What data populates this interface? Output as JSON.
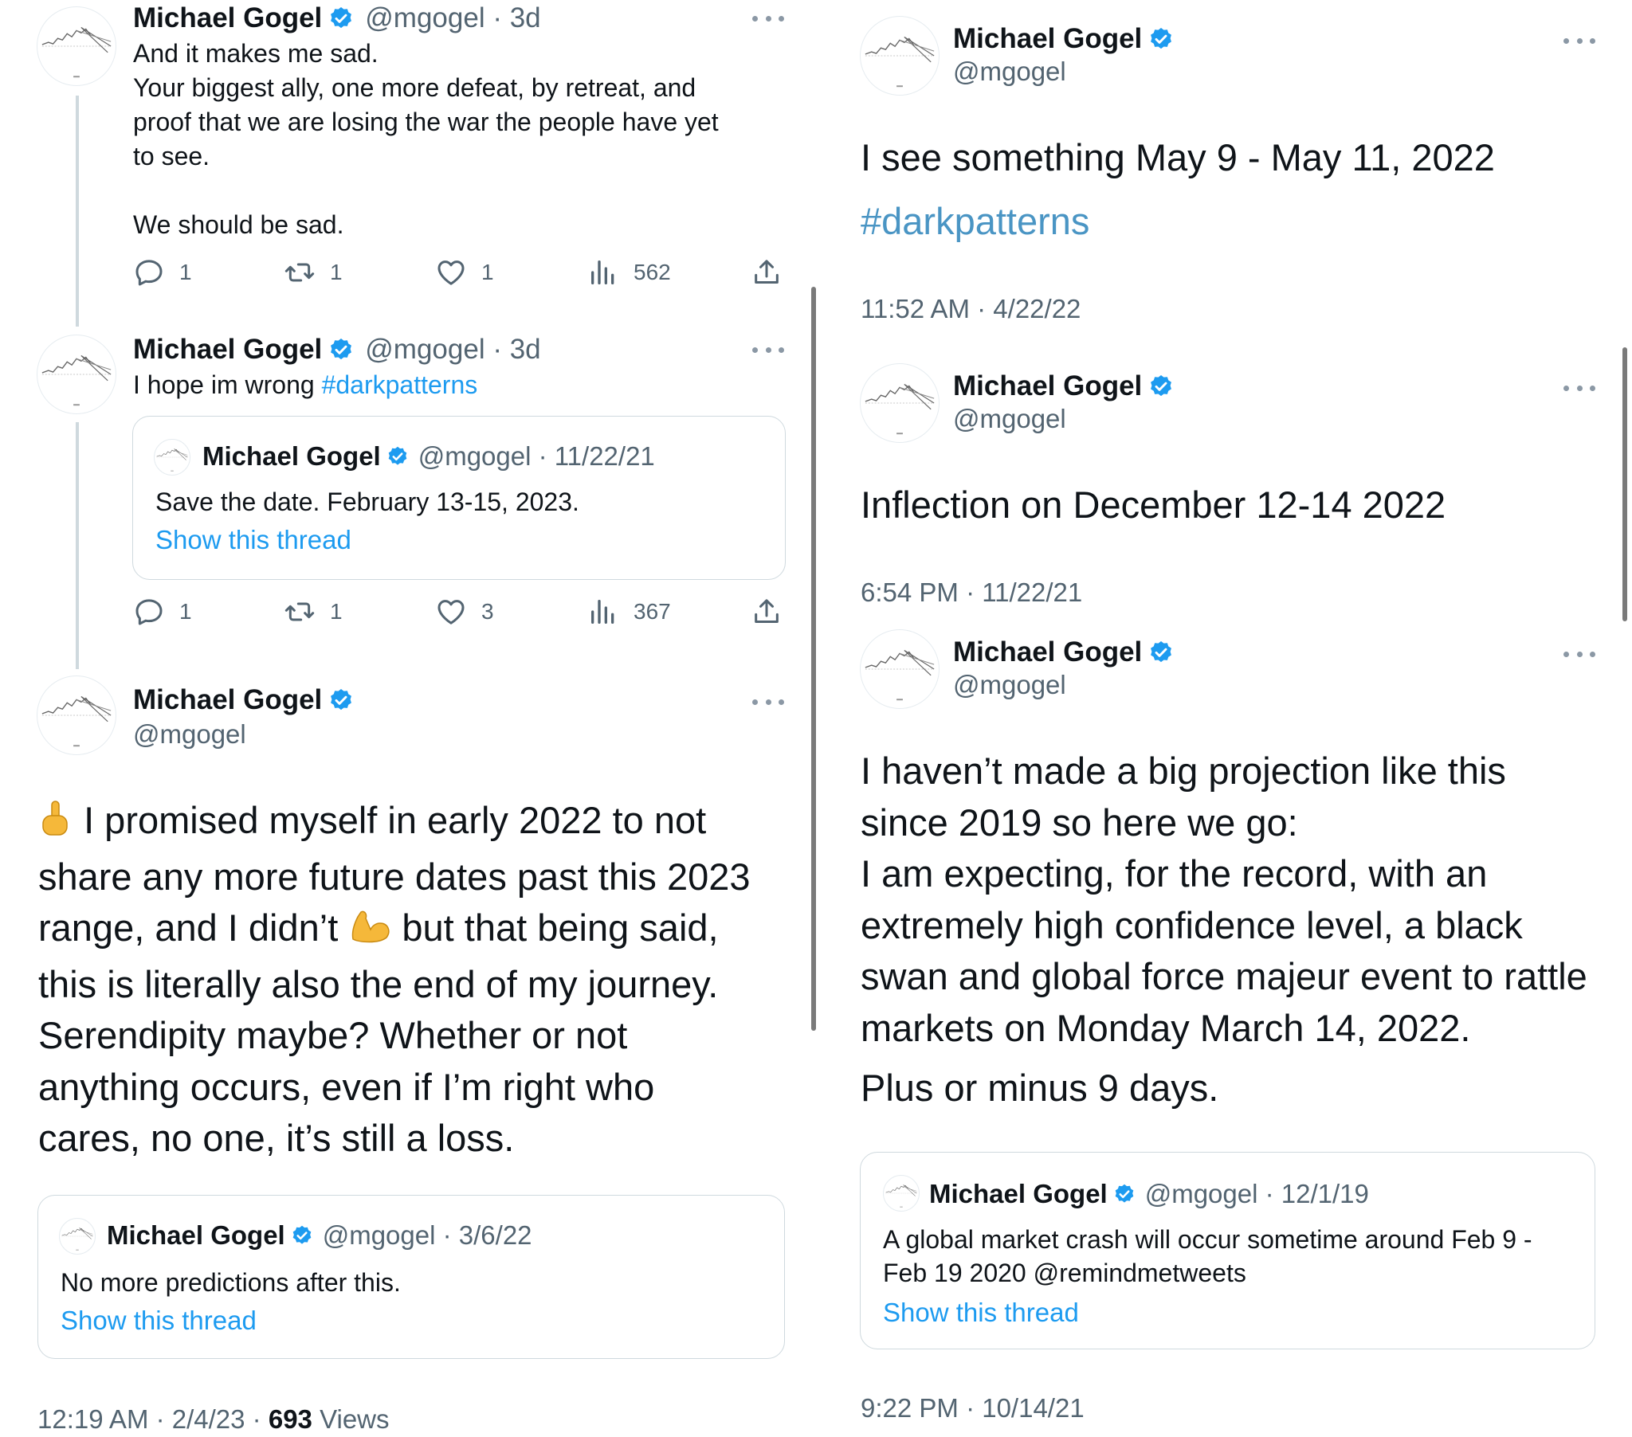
{
  "author": {
    "name": "Michael Gogel",
    "handle": "@mgogel"
  },
  "left": {
    "tweet1": {
      "meta": "@mgogel · 3d",
      "text": "And it makes me sad.\nYour biggest ally, one more defeat, by retreat, and\nproof that we are losing the war the people have yet\nto see.\n\nWe should be sad.",
      "replies": "1",
      "retweets": "1",
      "likes": "1",
      "views": "562"
    },
    "tweet2": {
      "meta": "@mgogel · 3d",
      "text_plain": "I hope im wrong ",
      "hashtag": "#darkpatterns",
      "quote": {
        "meta": "@mgogel · 11/22/21",
        "text": "Save the date. February 13-15, 2023.",
        "link": "Show this thread"
      },
      "replies": "1",
      "retweets": "1",
      "likes": "3",
      "views": "367"
    },
    "main": {
      "line1": "I promised myself in early 2022 to not",
      "line2": "share any more future dates past this 2023",
      "line3a": "range, and I didn’t ",
      "line3b": " but that being said,",
      "rest": "this is literally also the end of my journey.\nSerendipity maybe? Whether or not\nanything occurs, even if I’m right who\ncares, no one, it’s still a loss.",
      "quote": {
        "meta": "@mgogel · 3/6/22",
        "text": "No more predictions after this.",
        "link": "Show this thread"
      },
      "timestamp": "12:19 AM · 2/4/23 · ",
      "views_count": "693",
      "views_label": " Views"
    }
  },
  "right": {
    "tweet1": {
      "text": "I see something May 9 - May 11, 2022",
      "hashtag": "#darkpatterns",
      "timestamp": "11:52 AM · 4/22/22"
    },
    "tweet2": {
      "text": "Inflection on December 12-14 2022",
      "timestamp": "6:54 PM · 11/22/21"
    },
    "tweet3": {
      "text": "I haven’t made a big projection like this\nsince 2019 so here we go:\nI am expecting, for the record, with an\nextremely high confidence level, a black\nswan and global force majeur event to rattle\nmarkets on Monday March 14, 2022.",
      "text2": "Plus or minus 9 days.",
      "quote": {
        "meta": "@mgogel · 12/1/19",
        "text": "A global market crash will occur sometime around Feb 9 -\nFeb 19 2020 @remindmetweets",
        "link": "Show this thread"
      },
      "timestamp": "9:22 PM · 10/14/21"
    }
  },
  "icons": {
    "reply": "reply-icon",
    "retweet": "retweet-icon",
    "like": "heart-icon",
    "views": "views-icon",
    "share": "share-icon",
    "verified": "verified-badge-icon",
    "more": "more-icon",
    "point": "point-up-emoji-icon",
    "flex": "flexed-biceps-emoji-icon"
  },
  "colors": {
    "link": "#1d9bf0",
    "verified": "#1d9bf0",
    "muted": "#536471"
  }
}
